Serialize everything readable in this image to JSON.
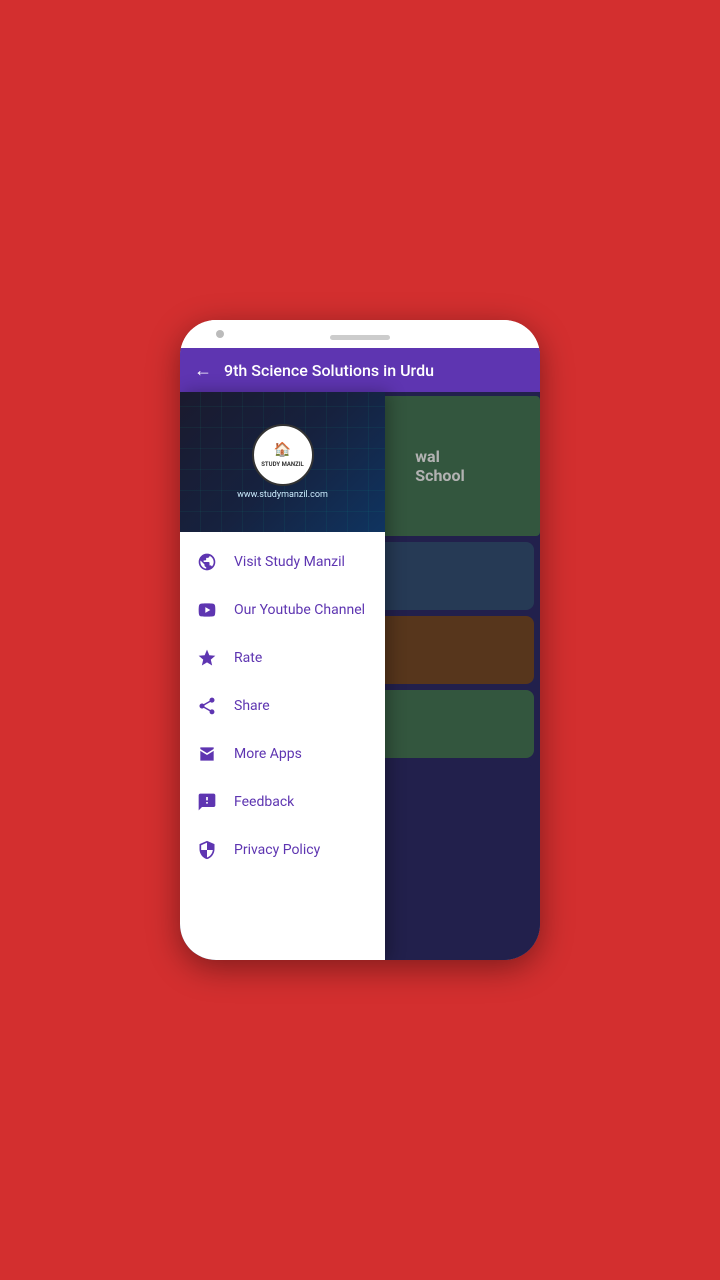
{
  "phone": {
    "background_color": "#d32f2f"
  },
  "header": {
    "title": "9th Science Solutions in Urdu",
    "back_label": "←"
  },
  "drawer": {
    "logo_text": "STUDY MANZIL",
    "website_url": "www.studymanzil.com",
    "menu_items": [
      {
        "id": "visit",
        "label": "Visit Study Manzil",
        "icon": "website-icon"
      },
      {
        "id": "youtube",
        "label": "Our Youtube Channel",
        "icon": "youtube-icon"
      },
      {
        "id": "rate",
        "label": "Rate",
        "icon": "star-icon"
      },
      {
        "id": "share",
        "label": "Share",
        "icon": "share-icon"
      },
      {
        "id": "more-apps",
        "label": "More Apps",
        "icon": "more-apps-icon"
      },
      {
        "id": "feedback",
        "label": "Feedback",
        "icon": "feedback-icon"
      },
      {
        "id": "privacy",
        "label": "Privacy Policy",
        "icon": "privacy-icon"
      }
    ]
  },
  "background_cards": [
    {
      "id": "card1",
      "color": "#37547a"
    },
    {
      "id": "card2",
      "color": "#7d4e29"
    },
    {
      "id": "card3",
      "color": "#4a7c59"
    }
  ]
}
